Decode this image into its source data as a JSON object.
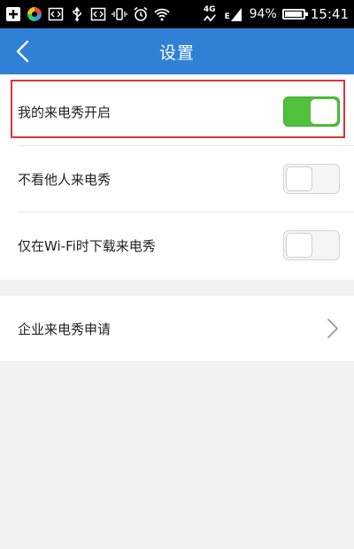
{
  "status_bar": {
    "battery_text": "94%",
    "battery_level": 0.94,
    "time": "15:41",
    "net_label_top": "4G",
    "net_label_bottom": "E",
    "icons_left": [
      "plus-icon",
      "app-logo-icon",
      "code-icon",
      "usb-icon",
      "code-icon",
      "vibrate-icon",
      "alarm-icon",
      "wifi-icon"
    ],
    "icons_right": [
      "signal-4g-icon",
      "signal-e-icon",
      "battery-icon"
    ]
  },
  "header": {
    "title": "设置",
    "back_icon": "chevron-left-icon",
    "background": "#2f80d6"
  },
  "settings": {
    "items": [
      {
        "label": "我的来电秀开启",
        "type": "toggle",
        "on": true
      },
      {
        "label": "不看他人来电秀",
        "type": "toggle",
        "on": false
      },
      {
        "label": "仅在Wi-Fi时下载来电秀",
        "type": "toggle",
        "on": false
      }
    ],
    "company": {
      "label": "企业来电秀申请",
      "icon": "chevron-right-icon"
    }
  },
  "colors": {
    "toggle_on": "#4fc13a",
    "highlight_border": "#d9343b"
  }
}
